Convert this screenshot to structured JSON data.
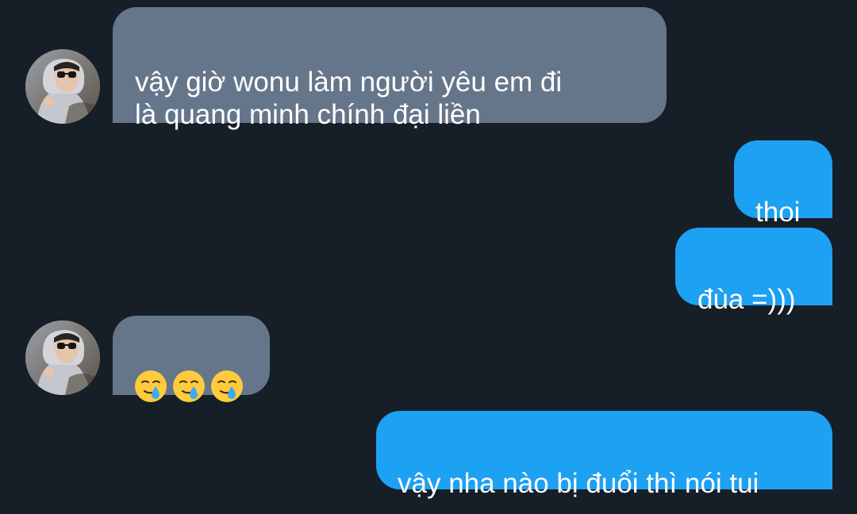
{
  "conversation": {
    "messages": [
      {
        "direction": "incoming",
        "text": "vậy giờ wonu làm người yêu em đi\nlà quang minh chính đại liền"
      },
      {
        "direction": "outgoing",
        "text": "thoi"
      },
      {
        "direction": "outgoing",
        "text": "đùa =)))"
      },
      {
        "direction": "incoming",
        "emojis": [
          "face-holding-back-tears",
          "face-holding-back-tears",
          "face-holding-back-tears"
        ]
      },
      {
        "direction": "outgoing",
        "text": "vậy nha nào bị đuổi thì nói tui"
      }
    ]
  },
  "colors": {
    "background": "#161E28",
    "incoming_bubble": "#66768A",
    "outgoing_bubble": "#1DA1F2",
    "text": "#FFFFFF"
  }
}
